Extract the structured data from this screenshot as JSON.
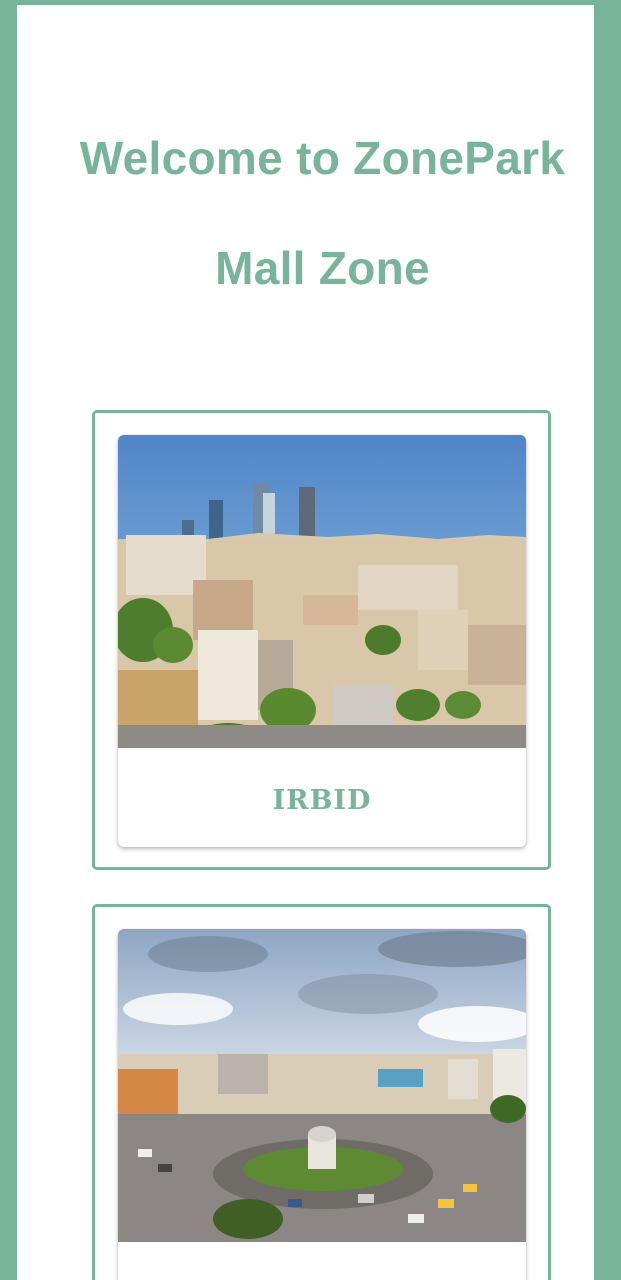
{
  "header": {
    "welcome": "Welcome to ZonePark",
    "subtitle": "Mall Zone"
  },
  "cards": [
    {
      "title": "IRBID",
      "image": "city-skyline-photo"
    },
    {
      "title": "",
      "image": "city-roundabout-photo"
    }
  ],
  "colors": {
    "accent": "#77b49a",
    "background": "#ffffff"
  }
}
